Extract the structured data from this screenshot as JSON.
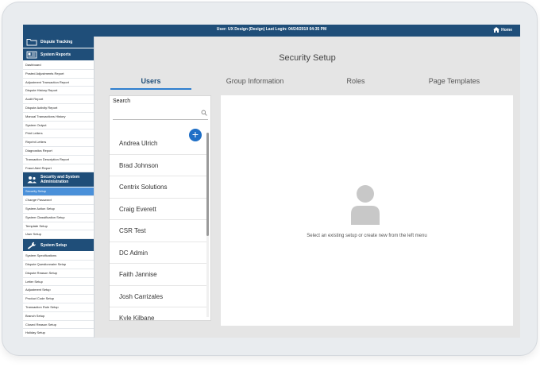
{
  "topbar": {
    "user_info": "User: UX Design (Design)   Last Login: 04/24/2019 04:35 PM",
    "home_label": "Home"
  },
  "sidebar": {
    "dispute_tracking": "Dispute Tracking",
    "system_reports": "System Reports",
    "report_items": [
      "Dashboard",
      "Posted Adjustments Report",
      "Adjustment Transaction Report",
      "Dispute History Report",
      "Audit Report",
      "Dispute Activity Report",
      "Manual Transactions History",
      "System Output",
      "Print Letters",
      "Reprint Letters",
      "Diagnostics Report",
      "Transaction Description Report",
      "Fraud Alert Report"
    ],
    "security_admin": "Security and System Administration",
    "security_items": [
      "Security Setup",
      "Change Password",
      "System Action Setup",
      "System Classification Setup",
      "Template Setup",
      "User Setup"
    ],
    "system_setup": "System Setup",
    "setup_items": [
      "System Specifications",
      "Dispute Questionnaire Setup",
      "Dispute Reason Setup",
      "Letter Setup",
      "Adjustment Setup",
      "Product Code Setup",
      "Transaction Rule Setup",
      "Branch Setup",
      "Closed Reason Setup",
      "Holiday Setup"
    ]
  },
  "main": {
    "title": "Security Setup",
    "tabs": [
      "Users",
      "Group Information",
      "Roles",
      "Page Templates"
    ],
    "search_label": "Search",
    "search_value": "",
    "add_symbol": "+",
    "users": [
      "Andrea Ulrich",
      "Brad Johnson",
      "Centrix Solutions",
      "Craig Everett",
      "CSR Test",
      "DC Admin",
      "Faith Jannise",
      "Josh Carrizales",
      "Kyle Kilbane"
    ],
    "empty_message": "Select an existing setup or create new from the left menu"
  },
  "colors": {
    "navy": "#1f4e79",
    "accent_blue": "#2f7fcf",
    "active_item": "#4a90d9",
    "add_button": "#1f6fc6"
  },
  "icons": {
    "dispute_tracking": "folder-icon",
    "system_reports": "report-icon",
    "security_admin": "users-icon",
    "system_setup": "wrench-icon",
    "home": "home-icon",
    "search": "search-icon",
    "avatar": "person-icon"
  }
}
